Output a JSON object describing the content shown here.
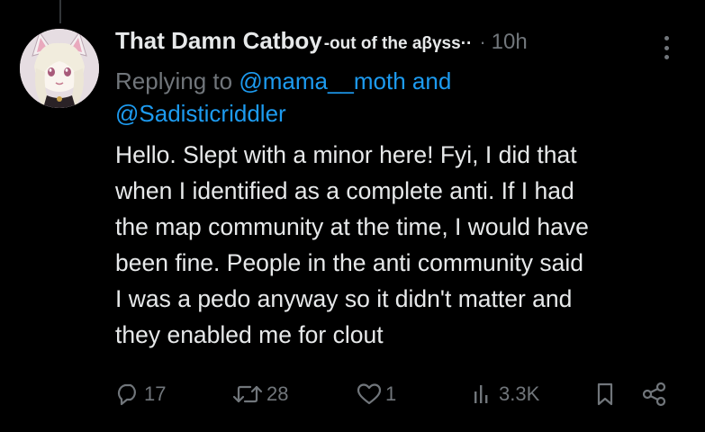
{
  "tweet": {
    "display_name": "That Damn Catboy",
    "name_suffix": "-out of the aβγss··",
    "dot": "·",
    "timestamp": "10h",
    "reply_prefix": "Replying to",
    "reply_user_1": "@mama__moth",
    "reply_and": "and",
    "reply_user_2": "@Sadisticriddler",
    "body_lines": [
      "Hello. Slept with a minor here! Fyi, I did that",
      "when I identified as a complete anti. If I had",
      "the map community at the time, I would have",
      "been fine. People in the anti community said",
      "I was a pedo anyway so it didn't matter and",
      "they enabled me for clout"
    ]
  },
  "actions": {
    "replies": "17",
    "reposts": "28",
    "likes": "1",
    "views": "3.3K"
  },
  "icons": {
    "reply": "reply-icon",
    "repost": "repost-icon",
    "like": "heart-icon",
    "views": "views-icon",
    "bookmark": "bookmark-icon",
    "share": "share-icon",
    "more": "more-vertical-icon"
  },
  "colors": {
    "background": "#000000",
    "text": "#e7e9ea",
    "muted": "#71767b",
    "link": "#1d9bf0"
  }
}
